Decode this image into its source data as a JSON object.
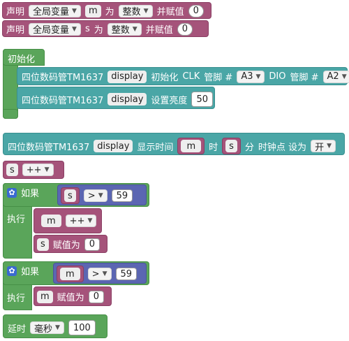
{
  "declare": {
    "label": "声明",
    "scope": "全局变量",
    "verb": "为",
    "type": "整数",
    "assign": "并赋值",
    "vars": [
      {
        "name": "m",
        "value": "0"
      },
      {
        "name": "s",
        "value": "0"
      }
    ]
  },
  "setup": {
    "title": "初始化",
    "init": {
      "device": "四位数码管TM1637",
      "var": "display",
      "action": "初始化",
      "clk_label": "CLK",
      "pin_label": "管脚 #",
      "clk_pin": "A3",
      "dio_label": "DIO",
      "dio_pin": "A2"
    },
    "brightness": {
      "device": "四位数码管TM1637",
      "var": "display",
      "action": "设置亮度",
      "value": "50"
    }
  },
  "loop": {
    "show_time": {
      "device": "四位数码管TM1637",
      "var": "display",
      "action": "显示时间",
      "hour_var": "m",
      "hour_label": "时",
      "min_var": "s",
      "min_label": "分",
      "colon_label": "时钟点 设为",
      "colon_value": "开"
    },
    "inc_s": {
      "var": "s",
      "op": "++"
    },
    "if1": {
      "if_label": "如果",
      "do_label": "执行",
      "var": "s",
      "cmp": ">",
      "value": "59",
      "inc": {
        "var": "m",
        "op": "++"
      },
      "assign": {
        "var": "s",
        "label": "赋值为",
        "value": "0"
      }
    },
    "if2": {
      "if_label": "如果",
      "do_label": "执行",
      "var": "m",
      "cmp": ">",
      "value": "59",
      "assign": {
        "var": "m",
        "label": "赋值为",
        "value": "0"
      }
    },
    "delay": {
      "label": "延时",
      "unit": "毫秒",
      "value": "100"
    }
  },
  "colors": {
    "variable": "#a5537a",
    "control": "#5aa55a",
    "tm1637": "#4aa6a6",
    "logic": "#5b66b2"
  }
}
